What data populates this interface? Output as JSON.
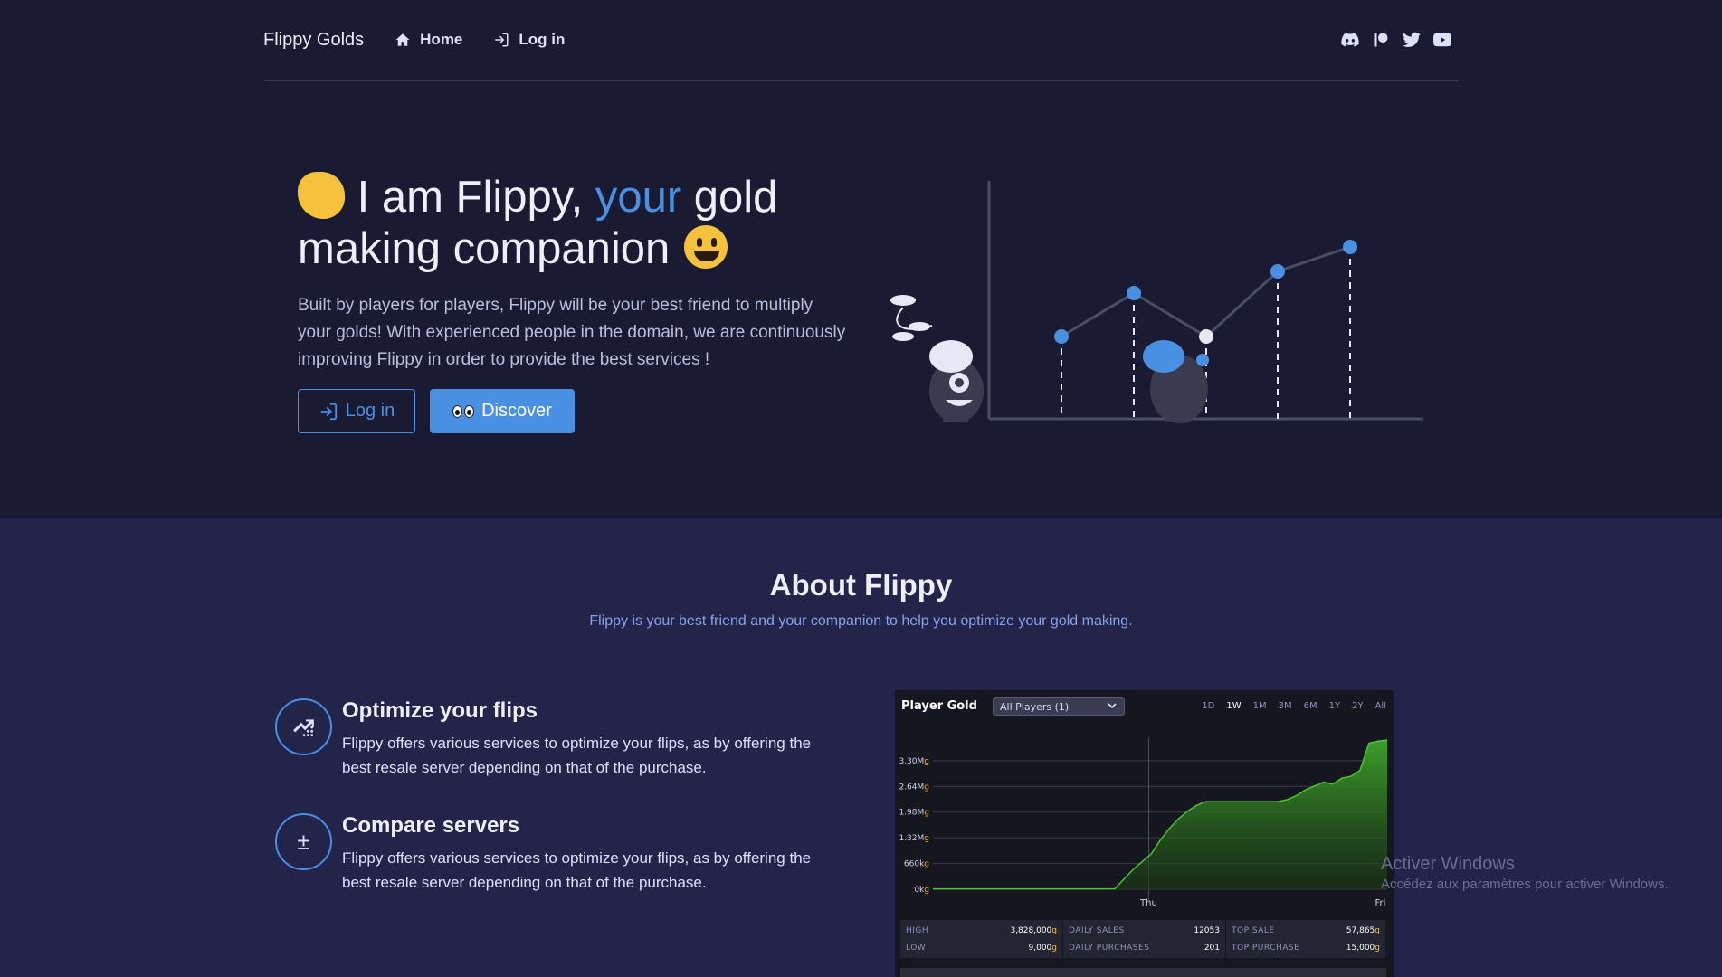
{
  "nav": {
    "brand": "Flippy Golds",
    "home": "Home",
    "login": "Log in"
  },
  "hero": {
    "title_part1": "I am Flippy, ",
    "title_accent": "your",
    "title_part2": " gold making companion",
    "description": "Built by players for players, Flippy will be your best friend to multiply your golds! With experienced people in the domain, we are continuously improving Flippy in order to provide the best services !",
    "login_button": "Log in",
    "discover_button": "Discover"
  },
  "about": {
    "title": "About Flippy",
    "subtitle": "Flippy is your best friend and your companion to help you optimize your gold making.",
    "features": [
      {
        "title": "Optimize your flips",
        "text": "Flippy offers various services to optimize your flips, as by offering the best resale server depending on that of the purchase."
      },
      {
        "title": "Compare servers",
        "text": "Flippy offers various services to optimize your flips, as by offering the best resale server depending on that of the purchase.",
        "icon_glyph": "±"
      }
    ]
  },
  "widget": {
    "title": "Player Gold",
    "select_value": "All Players (1)",
    "ranges": [
      "1D",
      "1W",
      "1M",
      "3M",
      "6M",
      "1Y",
      "2Y",
      "All"
    ],
    "active_range": "1W",
    "stats": {
      "high_label": "HIGH",
      "high_value": "3,828,000",
      "low_label": "LOW",
      "low_value": "9,000",
      "daily_sales_label": "DAILY SALES",
      "daily_sales_value": "12053",
      "daily_purchases_label": "DAILY PURCHASES",
      "daily_purchases_value": "201",
      "top_sale_label": "TOP SALE",
      "top_sale_value": "57,865",
      "top_purchase_label": "TOP PURCHASE",
      "top_purchase_value": "15,000",
      "unit": "g"
    }
  },
  "chart_data": {
    "type": "area",
    "title": "Player Gold",
    "xlabel": "",
    "ylabel": "",
    "y_ticks": [
      "0kg",
      "660kg",
      "1.32Mg",
      "1.98Mg",
      "2.64Mg",
      "3.30Mg"
    ],
    "y_tick_values": [
      0,
      660000,
      1320000,
      1980000,
      2640000,
      3300000
    ],
    "x_ticks": [
      "Thu",
      "Fri"
    ],
    "ylim": [
      0,
      3900000
    ],
    "color": "#2e8b1e",
    "x": [
      0,
      0.1,
      0.2,
      0.3,
      0.4,
      0.44,
      0.46,
      0.48,
      0.5,
      0.52,
      0.54,
      0.56,
      0.58,
      0.6,
      0.62,
      0.64,
      0.66,
      0.68,
      0.7,
      0.72,
      0.74,
      0.76,
      0.78,
      0.8,
      0.82,
      0.84,
      0.86,
      0.88,
      0.9,
      0.92,
      0.94,
      0.96,
      0.98,
      1.0
    ],
    "values": [
      9000,
      9000,
      9000,
      9000,
      9000,
      500000,
      700000,
      900000,
      1250000,
      1550000,
      1800000,
      2000000,
      2150000,
      2250000,
      2250000,
      2250000,
      2250000,
      2250000,
      2250000,
      2250000,
      2250000,
      2250000,
      2300000,
      2400000,
      2550000,
      2650000,
      2750000,
      2700000,
      2850000,
      2900000,
      3050000,
      3750000,
      3800000,
      3828000
    ]
  },
  "watermark": {
    "line1": "Activer Windows",
    "line2": "Accédez aux paramètres pour activer Windows."
  }
}
